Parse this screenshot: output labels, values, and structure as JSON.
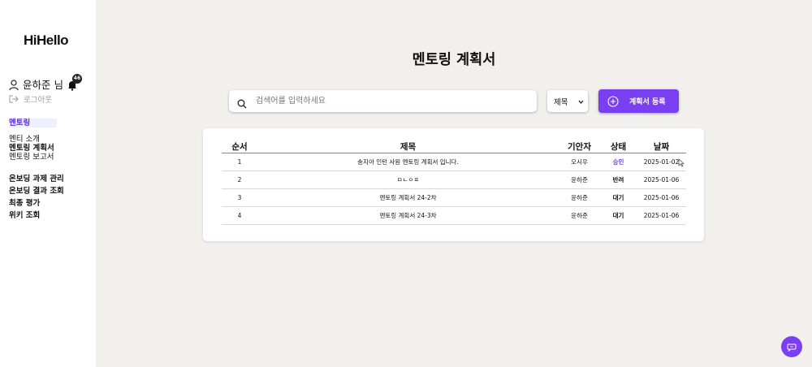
{
  "app": {
    "logo": "HiHello"
  },
  "user": {
    "name": "윤하준 님",
    "notification_count": "46",
    "logout_label": "로그아웃"
  },
  "sidebar": {
    "section": "멘토링",
    "sub_items": [
      {
        "label": "멘티 소개",
        "active": false
      },
      {
        "label": "멘토링 계획서",
        "active": true
      },
      {
        "label": "멘토링 보고서",
        "active": false
      }
    ],
    "main_items": [
      {
        "label": "온보딩 과제 관리"
      },
      {
        "label": "온보딩 결과 조회"
      },
      {
        "label": "최종 평가"
      },
      {
        "label": "위키 조회"
      }
    ]
  },
  "page": {
    "title": "멘토링 계획서"
  },
  "search": {
    "placeholder": "검색어를 입력하세요",
    "value": ""
  },
  "filter": {
    "selected": "제목"
  },
  "actions": {
    "register_label": "계획서 등록"
  },
  "table": {
    "columns": [
      "순서",
      "제목",
      "기안자",
      "상태",
      "날짜"
    ],
    "rows": [
      {
        "no": "1",
        "title": "송지아 인턴 사원 멘토링 계획서 입니다.",
        "author": "오시우",
        "status": "승인",
        "date": "2025-01-02"
      },
      {
        "no": "2",
        "title": "ㅁㄴㅇㅍ",
        "author": "윤하준",
        "status": "반려",
        "date": "2025-01-06"
      },
      {
        "no": "3",
        "title": "멘토링 계획서 24-2차",
        "author": "윤하준",
        "status": "대기",
        "date": "2025-01-06"
      },
      {
        "no": "4",
        "title": "멘토링 계획서 24-3차",
        "author": "윤하준",
        "status": "대기",
        "date": "2025-01-06"
      }
    ]
  },
  "colors": {
    "accent": "#7b3ff2",
    "approved": "#6a3de8",
    "background": "#f2f0ec"
  }
}
